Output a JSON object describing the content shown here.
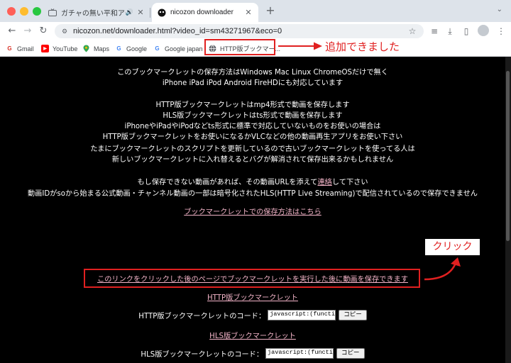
{
  "browser": {
    "tabs": [
      {
        "title": "ガチャの無い平和アクション",
        "active": false
      },
      {
        "title": "nicozon downloader",
        "active": true
      }
    ],
    "address_bar": {
      "url": "nicozon.net/downloader.html?video_id=sm43271967&eco=0"
    },
    "bookmarks": [
      {
        "label": "Gmail",
        "icon": "gmail-icon"
      },
      {
        "label": "YouTube",
        "icon": "youtube-icon"
      },
      {
        "label": "Maps",
        "icon": "maps-icon"
      },
      {
        "label": "Google",
        "icon": "google-icon"
      },
      {
        "label": "Google japan",
        "icon": "google-icon"
      },
      {
        "label": "HTTP版ブックマー...",
        "icon": "globe-icon"
      }
    ]
  },
  "annotations": {
    "added_note": "追加できました",
    "click_note": "クリック",
    "color": "#e02020"
  },
  "page": {
    "intro_lines": [
      "このブックマークレットの保存方法はWindows Mac Linux ChromeOSだけで無く",
      "iPhone iPad iPod Android FireHDにも対応しています"
    ],
    "info_lines": [
      "HTTP版ブックマークレットはmp4形式で動画を保存します",
      "HLS版ブックマークレットはts形式で動画を保存します",
      "iPhoneやiPadやiPodなどts形式に標準で対応していないものをお使いの場合は",
      "HTTP版ブックマークレットをお使いになるかVLCなどの他の動画再生アプリをお使い下さい",
      "たまにブックマークレットのスクリプトを更新しているので古いブックマークレットを使ってる人は",
      "新しいブックマークレットに入れ替えるとバグが解消されて保存出来るかもしれません"
    ],
    "contact_before": "もし保存できない動画があれば、その動画URLを添えて",
    "contact_link": "連絡",
    "contact_after": "して下さい",
    "notice_line": "動画IDがsoから始まる公式動画・チャンネル動画の一部は暗号化されたHLS(HTTP Live Streaming)で配信されているので保存できません",
    "howto_link": "ブックマークレットでの保存方法はこちら",
    "main_link": "このリンクをクリックした後のページでブックマークレットを実行した後に動画を保存できます",
    "http_bookmarklet_link": "HTTP版ブックマークレット",
    "http_code_label": "HTTP版ブックマークレットのコード：",
    "http_code_value": "javascript:(function(){va",
    "copy_label": "コピー",
    "hls_bookmarklet_link": "HLS版ブックマークレット",
    "hls_code_label": "HLS版ブックマークレットのコード：",
    "hls_code_value": "javascript:(function(){va"
  }
}
